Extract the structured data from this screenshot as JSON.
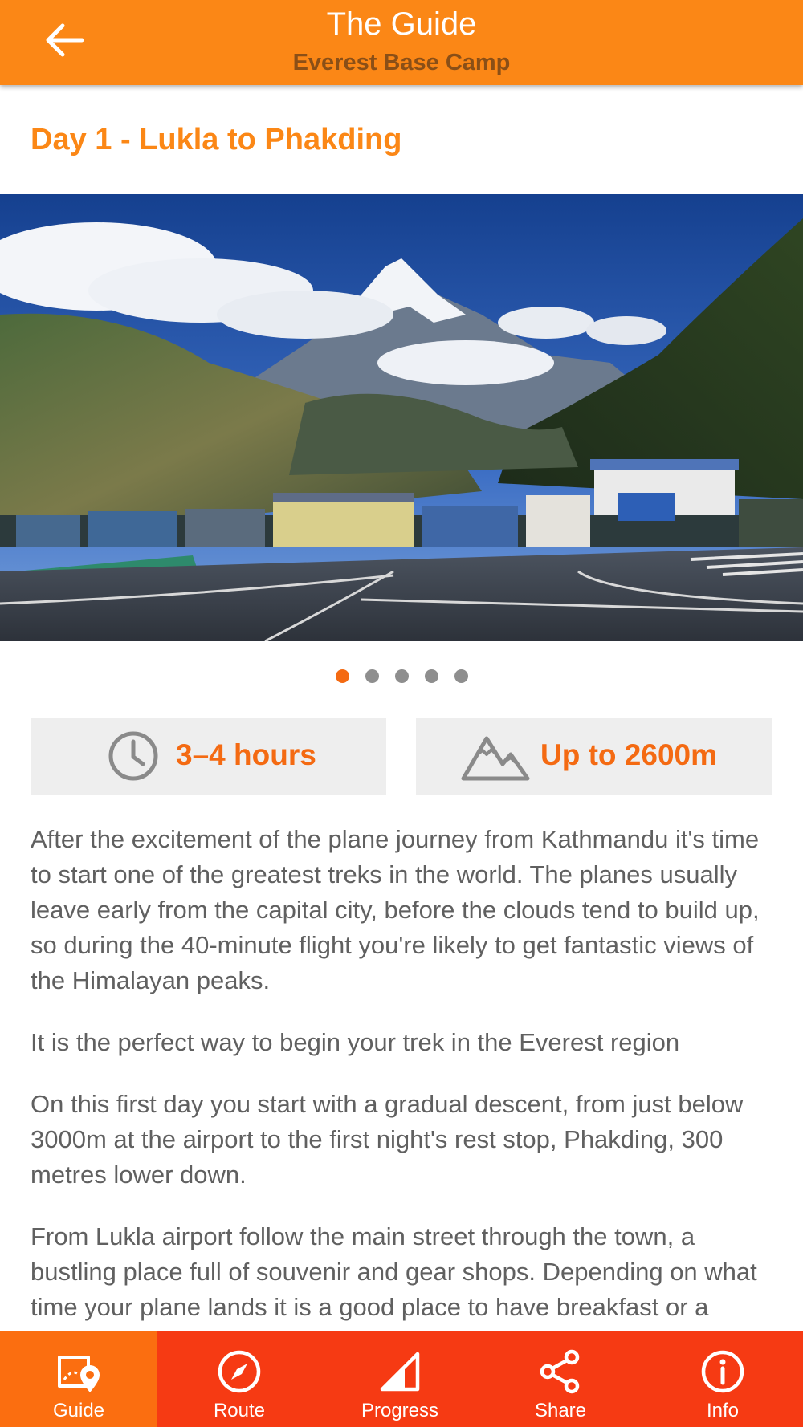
{
  "header": {
    "title": "The Guide",
    "subtitle": "Everest Base Camp",
    "back_icon": "arrow-left-icon",
    "background_color": "#fb8716"
  },
  "day": {
    "title": "Day 1 - Lukla to Phakding"
  },
  "hero_image": {
    "description_icon": "photo",
    "carousel": {
      "total": 5,
      "active_index": 0
    }
  },
  "stats": {
    "duration": {
      "icon": "clock-icon",
      "value": "3–4 hours"
    },
    "altitude": {
      "icon": "mountain-icon",
      "value": "Up to 2600m"
    }
  },
  "body": {
    "paragraphs": [
      "After the excitement of the plane journey from Kathmandu it's time to start one of the greatest treks in the world. The planes usually leave early from the capital city, before the clouds tend to build up, so during the 40-minute flight you're likely to get fantastic views of the Himalayan peaks.",
      "It is the perfect way to begin your trek in the Everest region",
      "On this first day you start with a gradual descent, from just below 3000m at the airport to the first night's rest stop, Phakding, 300 metres lower down.",
      "From Lukla airport follow the main street through the town, a bustling place full of souvenir and gear shops. Depending on what time your plane lands it is a good place to have breakfast or a lunch, though there are plenty of other options"
    ]
  },
  "tabbar": {
    "background_color": "#f63a13",
    "active_color": "#fb6e10",
    "tabs": [
      {
        "label": "Guide",
        "icon": "map-pin-icon",
        "active": true
      },
      {
        "label": "Route",
        "icon": "compass-icon",
        "active": false
      },
      {
        "label": "Progress",
        "icon": "progress-icon",
        "active": false
      },
      {
        "label": "Share",
        "icon": "share-icon",
        "active": false
      },
      {
        "label": "Info",
        "icon": "info-icon",
        "active": false
      }
    ]
  },
  "colors": {
    "accent": "#fb8716",
    "accent_dark": "#f46a12",
    "text": "#606060"
  }
}
